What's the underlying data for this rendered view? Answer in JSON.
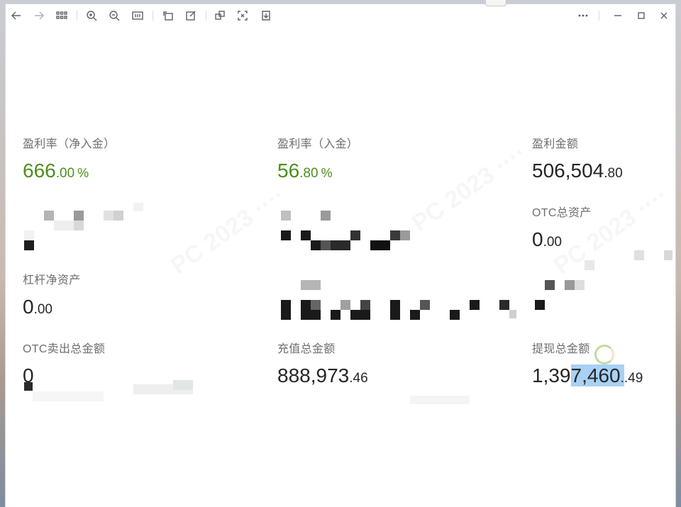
{
  "toolbar": {
    "icons": [
      "back-icon",
      "forward-icon",
      "grid-icon",
      "zoom-in-icon",
      "zoom-out-icon",
      "fit-width-icon",
      "rotate-icon",
      "edit-icon",
      "copy-icon",
      "fullscreen-icon",
      "download-icon",
      "more-icon",
      "minimize-icon",
      "maximize-icon",
      "close-icon"
    ]
  },
  "stats": {
    "profit_rate_net": {
      "label": "盈利率（净入金）",
      "int": "666",
      "dec": ".00",
      "unit": "%"
    },
    "profit_rate_in": {
      "label": "盈利率（入金）",
      "int": "56",
      "dec": ".80",
      "unit": "%"
    },
    "profit_amount": {
      "label": "盈利金额",
      "int": "506,504",
      "dec": ".80"
    },
    "otc_total_assets": {
      "label": "OTC总资产",
      "int": "0",
      "dec": ".00"
    },
    "leverage_net_assets": {
      "label": "杠杆净资产",
      "int": "0",
      "dec": ".00"
    },
    "otc_sell_total": {
      "label": "OTC卖出总金额",
      "int": "0"
    },
    "deposit_total": {
      "label": "充值总金额",
      "int": "888,973",
      "dec": ".46"
    },
    "withdraw_total": {
      "label": "提现总金额",
      "int_a": "1,39",
      "int_b": "7,460",
      "dec": ".49"
    }
  },
  "colors": {
    "positive": "#4c8f1d",
    "text": "#262626",
    "label": "#6e6e6e",
    "selection": "#a9d1f5"
  }
}
